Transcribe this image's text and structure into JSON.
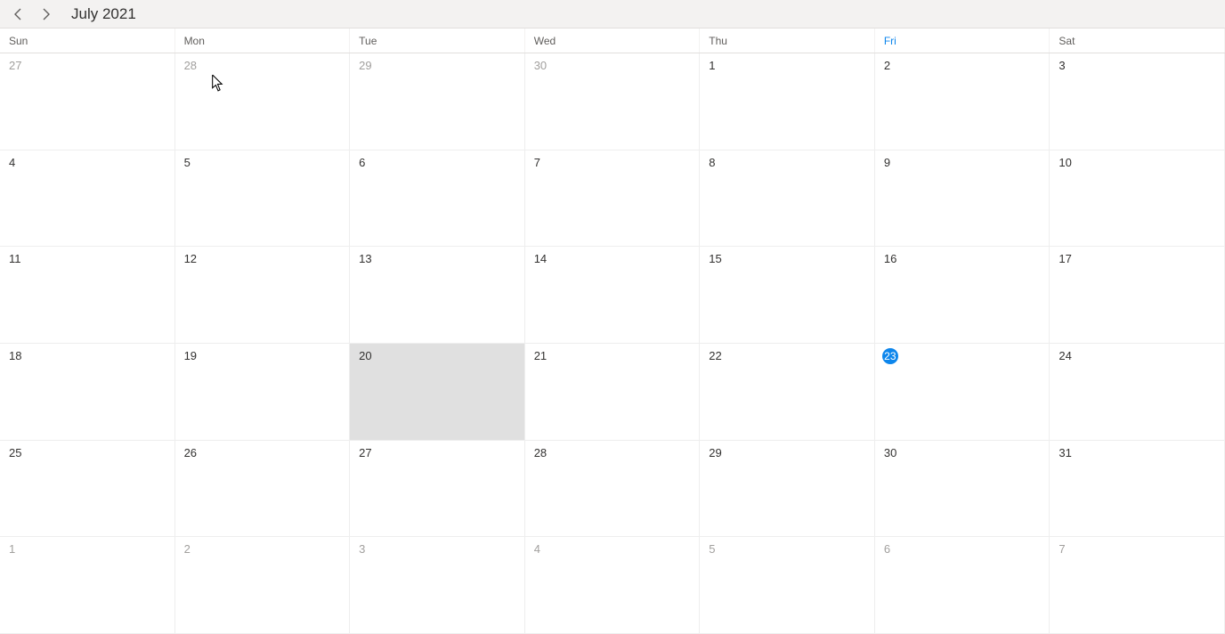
{
  "header": {
    "title": "July 2021"
  },
  "weekdays": [
    "Sun",
    "Mon",
    "Tue",
    "Wed",
    "Thu",
    "Fri",
    "Sat"
  ],
  "today_weekday_index": 5,
  "weeks": [
    [
      {
        "n": "27",
        "other": true
      },
      {
        "n": "28",
        "other": true
      },
      {
        "n": "29",
        "other": true
      },
      {
        "n": "30",
        "other": true
      },
      {
        "n": "1"
      },
      {
        "n": "2"
      },
      {
        "n": "3"
      }
    ],
    [
      {
        "n": "4"
      },
      {
        "n": "5"
      },
      {
        "n": "6"
      },
      {
        "n": "7"
      },
      {
        "n": "8"
      },
      {
        "n": "9"
      },
      {
        "n": "10"
      }
    ],
    [
      {
        "n": "11"
      },
      {
        "n": "12"
      },
      {
        "n": "13"
      },
      {
        "n": "14"
      },
      {
        "n": "15"
      },
      {
        "n": "16"
      },
      {
        "n": "17"
      }
    ],
    [
      {
        "n": "18"
      },
      {
        "n": "19"
      },
      {
        "n": "20",
        "selected": true
      },
      {
        "n": "21"
      },
      {
        "n": "22"
      },
      {
        "n": "23",
        "today": true
      },
      {
        "n": "24"
      }
    ],
    [
      {
        "n": "25"
      },
      {
        "n": "26"
      },
      {
        "n": "27"
      },
      {
        "n": "28"
      },
      {
        "n": "29"
      },
      {
        "n": "30"
      },
      {
        "n": "31"
      }
    ],
    [
      {
        "n": "1",
        "other": true
      },
      {
        "n": "2",
        "other": true
      },
      {
        "n": "3",
        "other": true
      },
      {
        "n": "4",
        "other": true
      },
      {
        "n": "5",
        "other": true
      },
      {
        "n": "6",
        "other": true
      },
      {
        "n": "7",
        "other": true
      }
    ]
  ]
}
